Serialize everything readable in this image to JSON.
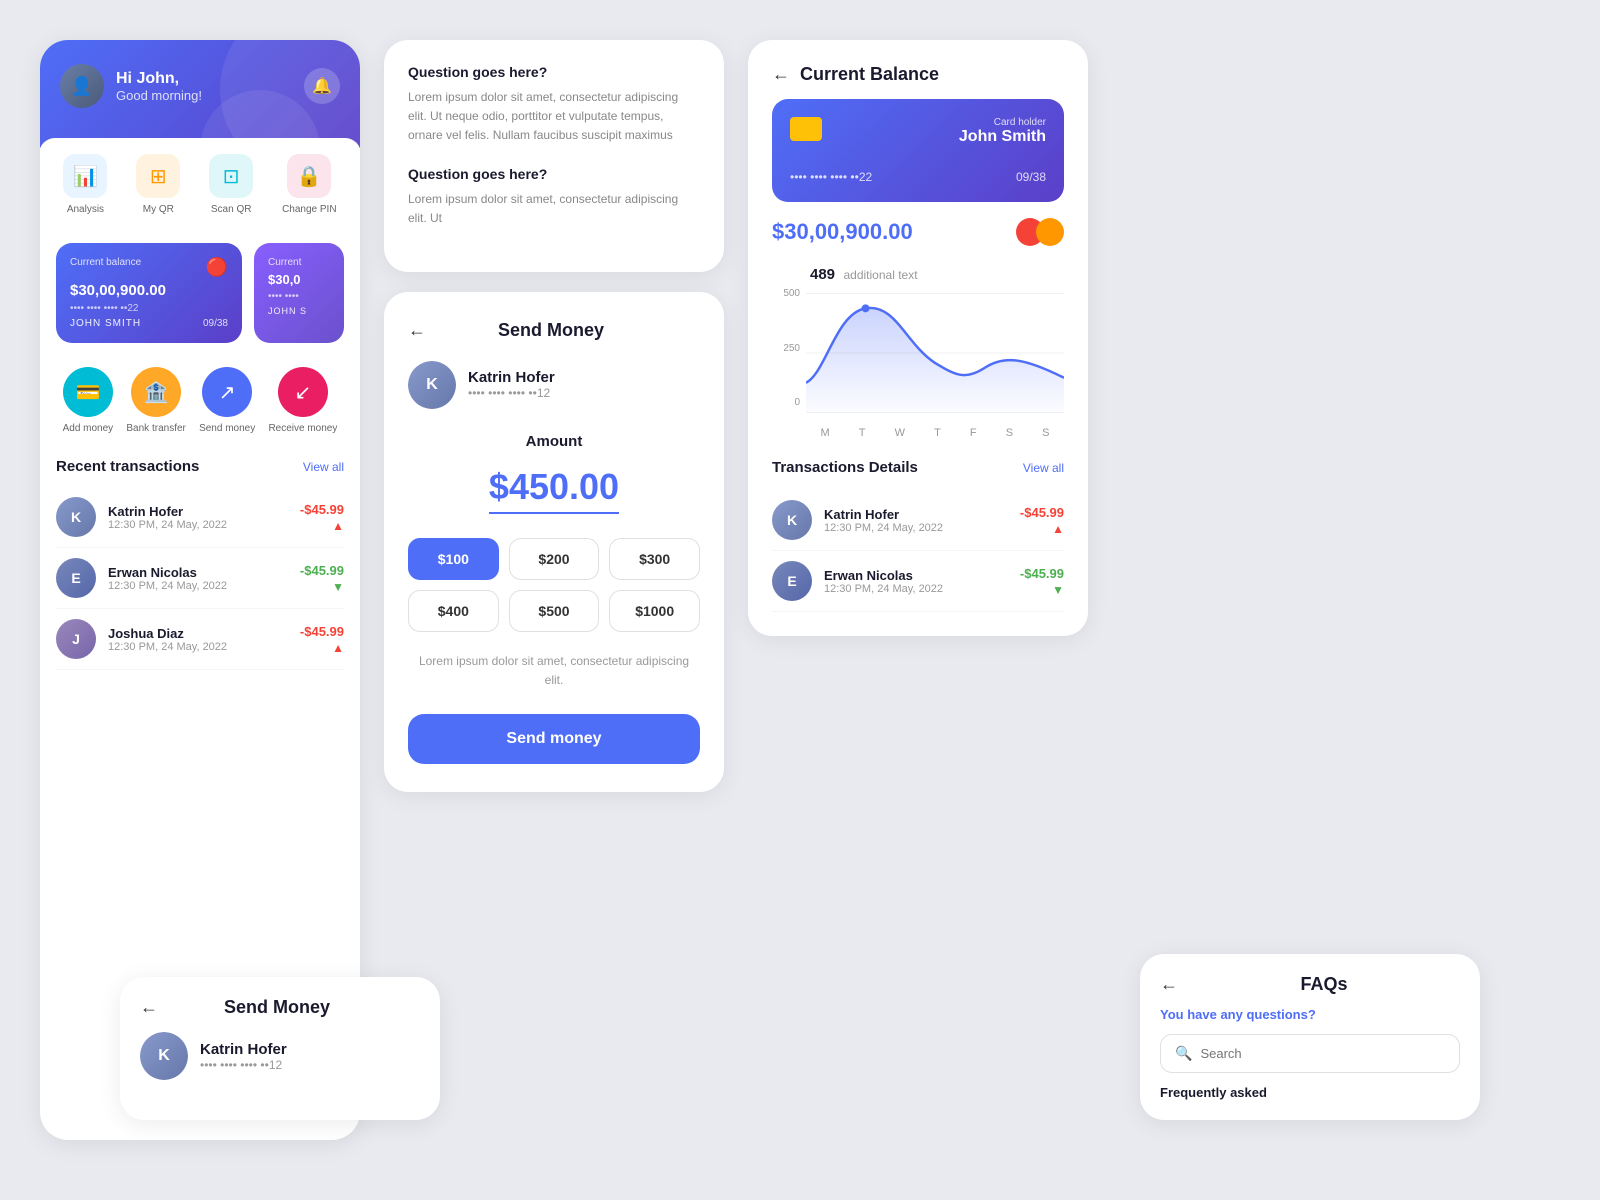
{
  "app": {
    "greeting": "Hi John,",
    "subgreeting": "Good morning!",
    "notif_icon": "🔔"
  },
  "quick_actions": [
    {
      "id": "analysis",
      "label": "Analysis",
      "icon": "📊",
      "color": "blue"
    },
    {
      "id": "my_qr",
      "label": "My QR",
      "icon": "⊞",
      "color": "orange"
    },
    {
      "id": "scan_qr",
      "label": "Scan QR",
      "icon": "⊡",
      "color": "cyan"
    },
    {
      "id": "change_pin",
      "label": "Change PIN",
      "icon": "🔒",
      "color": "red"
    }
  ],
  "cards": [
    {
      "label": "Current balance",
      "amount": "$30,00,900.00",
      "dots": "•••• •••• •••• ••22",
      "name": "JOHN SMITH",
      "expiry": "09/38"
    },
    {
      "label": "Current",
      "amount": "$30,0",
      "dots": "•••• ••••",
      "name": "JOHN S",
      "expiry": ""
    }
  ],
  "money_actions": [
    {
      "label": "Add money",
      "icon": "💳",
      "color": "teal"
    },
    {
      "label": "Bank transfer",
      "icon": "🏦",
      "color": "amber"
    },
    {
      "label": "Send money",
      "icon": "↗",
      "color": "blue"
    },
    {
      "label": "Receive money",
      "icon": "↙",
      "color": "pink"
    }
  ],
  "recent_transactions": {
    "title": "Recent transactions",
    "view_all": "View all",
    "items": [
      {
        "name": "Katrin Hofer",
        "date": "12:30 PM, 24 May, 2022",
        "amount": "-$45.99",
        "type": "debit"
      },
      {
        "name": "Erwan Nicolas",
        "date": "12:30 PM, 24 May, 2022",
        "amount": "-$45.99",
        "type": "credit"
      },
      {
        "name": "Joshua Diaz",
        "date": "12:30 PM, 24 May, 2022",
        "amount": "-$45.99",
        "type": "debit"
      }
    ]
  },
  "faq": {
    "questions": [
      {
        "question": "Question goes here?",
        "answer": "Lorem ipsum dolor sit amet, consectetur adipiscing elit. Ut neque odio, porttitor et vulputate tempus, ornare vel felis. Nullam faucibus suscipit maximus"
      },
      {
        "question": "Question goes here?",
        "answer": "Lorem ipsum dolor sit amet, consectetur adipiscing elit. Ut"
      }
    ]
  },
  "send_money": {
    "title": "Send Money",
    "recipient_name": "Katrin Hofer",
    "recipient_card": "•••• •••• •••• ••12",
    "amount_label": "Amount",
    "amount": "$450.00",
    "amounts": [
      "$100",
      "$200",
      "$300",
      "$400",
      "$500",
      "$1000"
    ],
    "selected_amount": "$100",
    "note": "Lorem ipsum dolor sit amet, consectetur adipiscing elit.",
    "send_button": "Send money"
  },
  "current_balance": {
    "title": "Current Balance",
    "card": {
      "holder_label": "Card holder",
      "holder_name": "John Smith",
      "card_number": "•••• •••• •••• ••22",
      "expiry": "09/38"
    },
    "balance": "$30,00,900.00",
    "chart": {
      "peak": "489",
      "peak_label": "additional text",
      "y_labels": [
        "500",
        "250",
        "0"
      ],
      "x_labels": [
        "M",
        "T",
        "W",
        "T",
        "F",
        "S",
        "S"
      ]
    },
    "transactions_details": {
      "title": "Transactions Details",
      "view_all": "View all",
      "items": [
        {
          "name": "Katrin Hofer",
          "date": "12:30 PM, 24 May, 2022",
          "amount": "-$45.99",
          "type": "debit"
        },
        {
          "name": "Erwan Nicolas",
          "date": "12:30 PM, 24 May, 2022",
          "amount": "-$45.99",
          "type": "credit"
        }
      ]
    }
  },
  "bottom_send_money": {
    "title": "Send Money",
    "recipient_name": "Katrin Hofer",
    "recipient_card": "•••• •••• •••• ••12"
  },
  "bottom_faq": {
    "title": "FAQs",
    "sub": "You have any questions?",
    "search_placeholder": "Search",
    "freq_title": "Frequently asked"
  }
}
